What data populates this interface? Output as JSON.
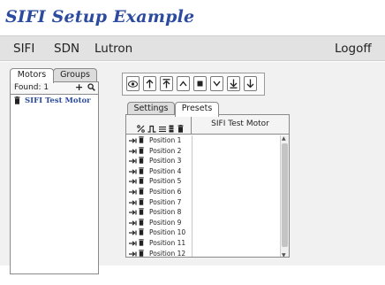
{
  "page_title": "SIFI Setup Example",
  "nav": {
    "items": [
      "SIFI",
      "SDN",
      "Lutron"
    ],
    "logoff": "Logoff"
  },
  "left_panel": {
    "tabs": [
      "Motors",
      "Groups"
    ],
    "active_tab": "Motors",
    "found_label": "Found: 1",
    "add_label": "+",
    "motors": [
      "SIFI Test Motor"
    ]
  },
  "toolbar": {
    "buttons": [
      "eye-icon",
      "arrow-up-icon",
      "arrow-up-to-top-icon",
      "chevron-up-icon",
      "stop-icon",
      "chevron-down-icon",
      "arrow-down-to-bottom-icon",
      "arrow-down-icon"
    ]
  },
  "right_panel": {
    "tabs": [
      "Settings",
      "Presets"
    ],
    "active_tab": "Presets",
    "header_icons": [
      "scissors-icon",
      "wave-icon",
      "list-icon",
      "column-icon",
      "trash-icon"
    ],
    "motor_column": "SIFI Test Motor",
    "positions": [
      "Position 1",
      "Position 2",
      "Position 3",
      "Position 4",
      "Position 5",
      "Position 6",
      "Position 7",
      "Position 8",
      "Position 9",
      "Position 10",
      "Position 11",
      "Position 12"
    ]
  },
  "colors": {
    "title": "#2c4b9e",
    "navbar": "#e2e2e2",
    "content_bg": "#f1f1f1"
  }
}
